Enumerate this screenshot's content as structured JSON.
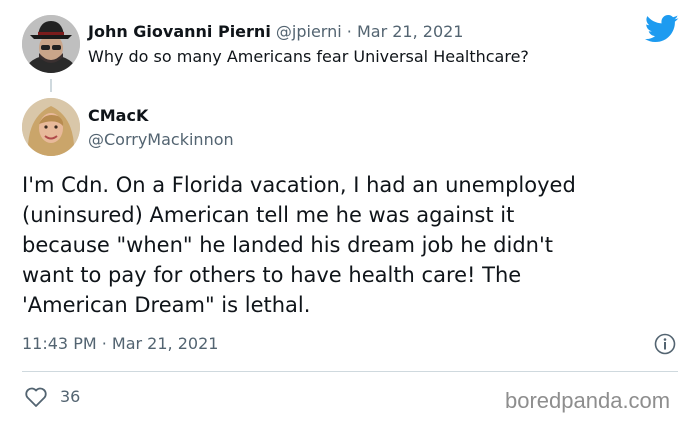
{
  "parent": {
    "name": "John Giovanni Pierni",
    "handle": "@jpierni",
    "separator": "·",
    "date": "Mar 21, 2021",
    "text": "Why do so many Americans fear Universal Healthcare?"
  },
  "reply": {
    "name": "CMacK",
    "handle": "@CorryMackinnon",
    "body_lines": [
      "I'm Cdn. On a Florida vacation, I had an unemployed",
      "(uninsured) American tell me he was against it",
      "because \"when\" he landed his dream job he didn't",
      "want to pay for others to have health care! The",
      "'American Dream\" is lethal."
    ],
    "timestamp": "11:43 PM · Mar 21, 2021",
    "likes": "36"
  },
  "watermark": "boredpanda.com",
  "icons": {
    "brand": "twitter-bird-icon",
    "info": "info-icon",
    "like": "heart-icon"
  },
  "colors": {
    "twitter_blue": "#1d9bf0",
    "text": "#0f1419",
    "muted": "#536471",
    "divider": "#cfd9de"
  }
}
